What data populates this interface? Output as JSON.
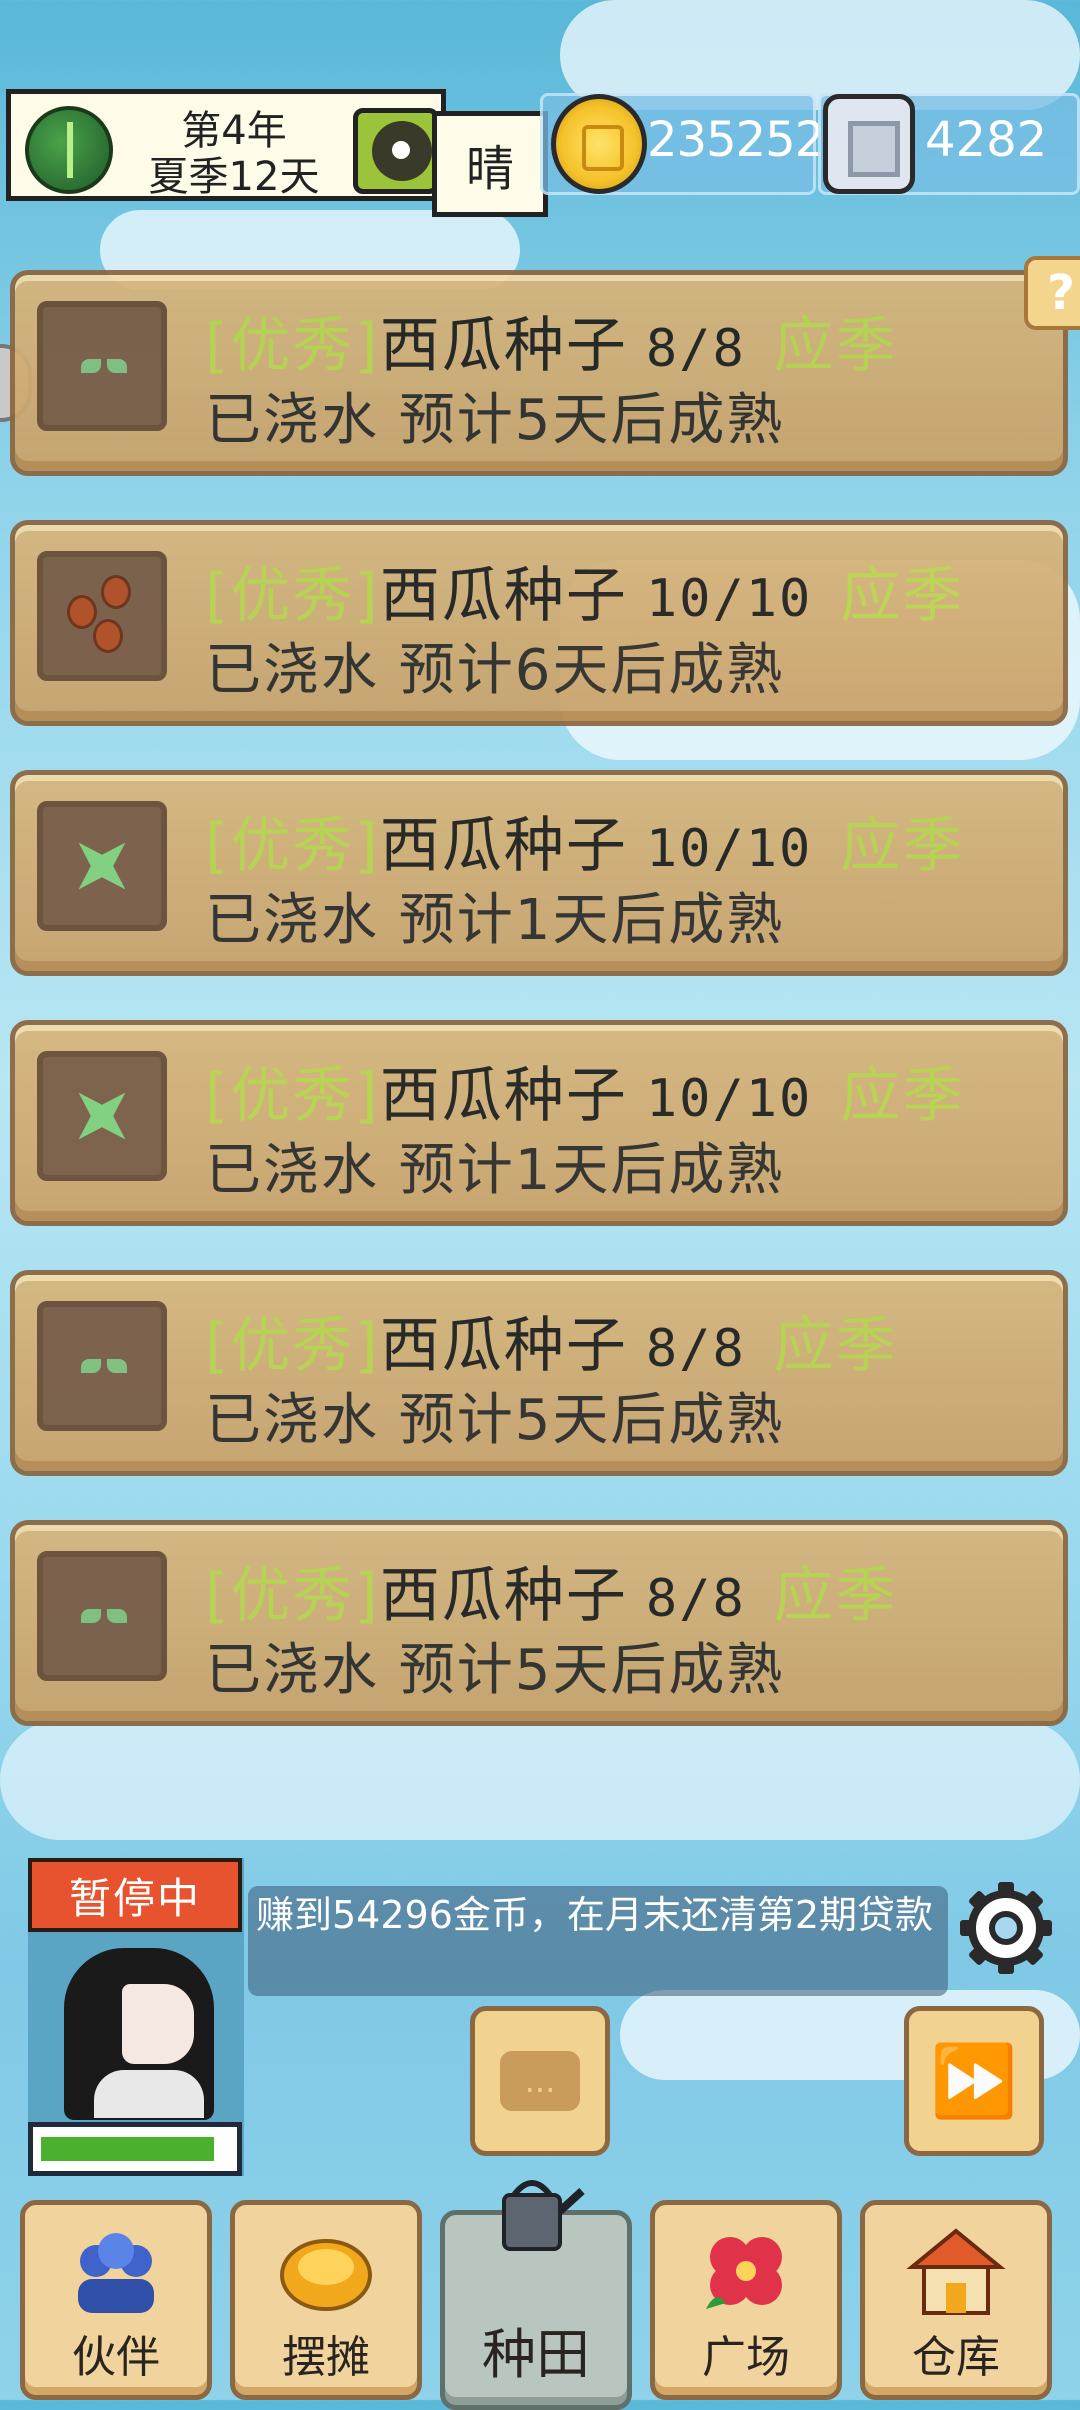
{
  "header": {
    "year_label": "第4年",
    "day_label": "夏季12天",
    "weather": "晴",
    "gold": "235252",
    "gems": "4282"
  },
  "help_label": "?",
  "plots": [
    {
      "quality": "[优秀]",
      "seed": "西瓜种子",
      "count": "8/8",
      "season": "应季",
      "status": "已浇水 预计5天后成熟",
      "icon": "sprout-icon"
    },
    {
      "quality": "[优秀]",
      "seed": "西瓜种子",
      "count": "10/10",
      "season": "应季",
      "status": "已浇水 预计6天后成熟",
      "icon": "seeds-icon"
    },
    {
      "quality": "[优秀]",
      "seed": "西瓜种子",
      "count": "10/10",
      "season": "应季",
      "status": "已浇水 预计1天后成熟",
      "icon": "leaf-icon"
    },
    {
      "quality": "[优秀]",
      "seed": "西瓜种子",
      "count": "10/10",
      "season": "应季",
      "status": "已浇水 预计1天后成熟",
      "icon": "leaf-icon"
    },
    {
      "quality": "[优秀]",
      "seed": "西瓜种子",
      "count": "8/8",
      "season": "应季",
      "status": "已浇水 预计5天后成熟",
      "icon": "sprout-icon"
    },
    {
      "quality": "[优秀]",
      "seed": "西瓜种子",
      "count": "8/8",
      "season": "应季",
      "status": "已浇水 预计5天后成熟",
      "icon": "sprout-icon"
    }
  ],
  "status": {
    "paused_label": "暂停中",
    "task_text": "赚到54296金币，在月末还清第2期贷款",
    "hp_fraction": 0.92
  },
  "chat_label": "...",
  "nav": [
    {
      "label": "伙伴",
      "icon": "partner-icon"
    },
    {
      "label": "摆摊",
      "icon": "stall-icon"
    },
    {
      "label": "种田",
      "icon": "watering-can-icon"
    },
    {
      "label": "广场",
      "icon": "flower-icon"
    },
    {
      "label": "仓库",
      "icon": "house-icon"
    }
  ],
  "colors": {
    "quality": "#b9d34a",
    "paused": "#e6532e",
    "plot_bg": "#d8b57a"
  }
}
